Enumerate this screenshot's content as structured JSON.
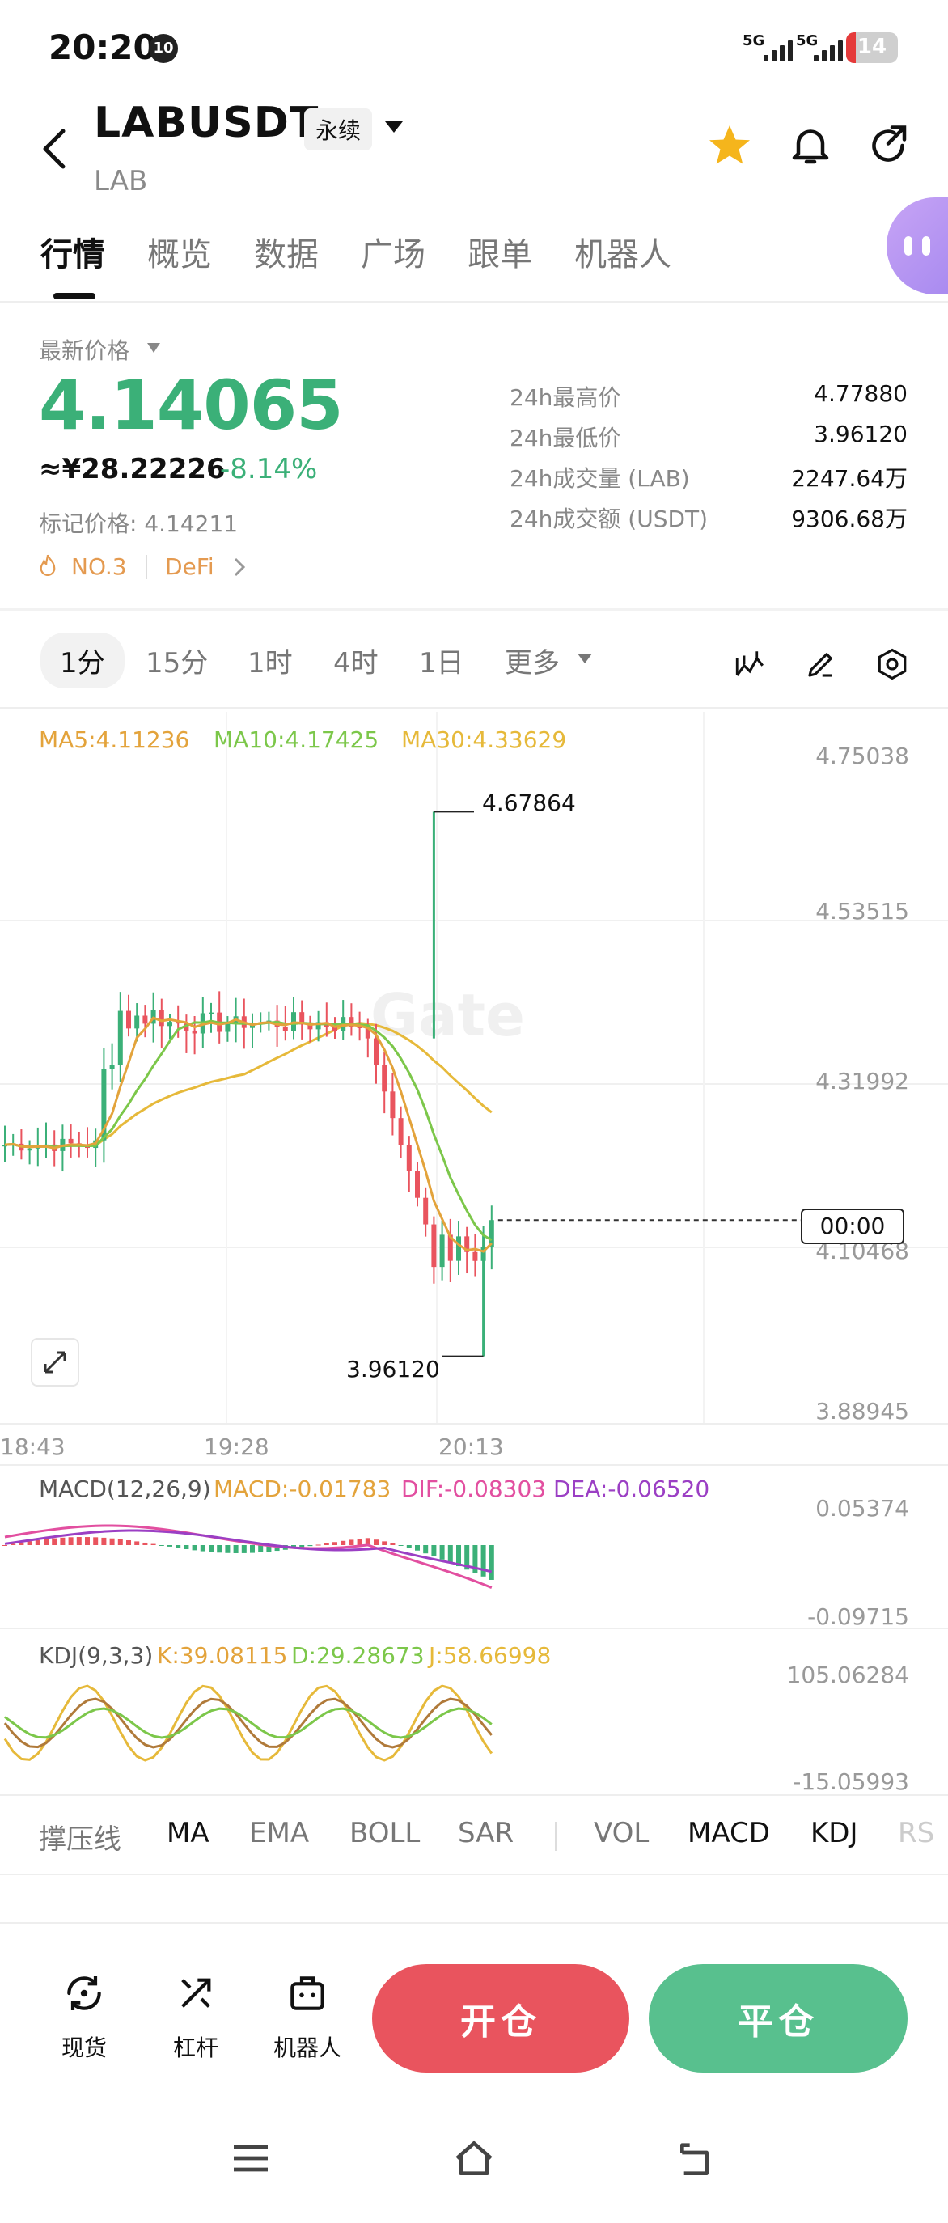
{
  "status": {
    "time": "20:20",
    "notif": "10",
    "net1": "5G",
    "net2": "5G",
    "battery": "14"
  },
  "header": {
    "pair": "LABUSDT",
    "contract_type": "永续",
    "base": "LAB"
  },
  "tabs": [
    "行情",
    "概览",
    "数据",
    "广场",
    "跟单",
    "机器人"
  ],
  "price_panel": {
    "latest_label": "最新价格",
    "last_price": "4.14065",
    "cny": "≈¥28.22226",
    "change": "-8.14%",
    "mark_price": "标记价格: 4.14211",
    "rank": "NO.3",
    "sector": "DeFi",
    "stats": [
      {
        "k": "24h最高价",
        "v": "4.77880"
      },
      {
        "k": "24h最低价",
        "v": "3.96120"
      },
      {
        "k": "24h成交量 (LAB)",
        "v": "2247.64万"
      },
      {
        "k": "24h成交额 (USDT)",
        "v": "9306.68万"
      }
    ]
  },
  "intervals": [
    "1分",
    "15分",
    "1时",
    "4时",
    "1日",
    "更多"
  ],
  "ma_line": {
    "ma5": "MA5:4.11236",
    "ma10": "MA10:4.17425",
    "ma30": "MA30:4.33629"
  },
  "price_axis": [
    "4.75038",
    "4.53515",
    "4.31992",
    "4.10468",
    "3.88945"
  ],
  "time_axis": [
    "18:43",
    "19:28",
    "20:13"
  ],
  "high_label": "4.67864",
  "low_label": "3.96120",
  "countdown": "00:00",
  "macd": {
    "title": "MACD(12,26,9)",
    "macd": "MACD:-0.01783",
    "dif": "DIF:-0.08303",
    "dea": "DEA:-0.06520",
    "axis_top": "0.05374",
    "axis_bottom": "-0.09715"
  },
  "kdj": {
    "title": "KDJ(9,3,3)",
    "k": "K:39.08115",
    "d": "D:29.28673",
    "j": "J:58.66998",
    "axis_top": "105.06284",
    "axis_bottom": "-15.05993"
  },
  "indicators": [
    "撑压线",
    "MA",
    "EMA",
    "BOLL",
    "SAR",
    "VOL",
    "MACD",
    "KDJ",
    "RS"
  ],
  "bottom": {
    "spot": "现货",
    "leverage": "杠杆",
    "bot": "机器人",
    "open": "开仓",
    "close": "平仓"
  },
  "colors": {
    "up": "#3bb078",
    "down": "#e9545e",
    "ma5": "#e3a33b",
    "ma10": "#7cc74a",
    "ma30": "#e6b93a",
    "dif": "#e24fa0",
    "dea": "#9b3fc4"
  }
}
